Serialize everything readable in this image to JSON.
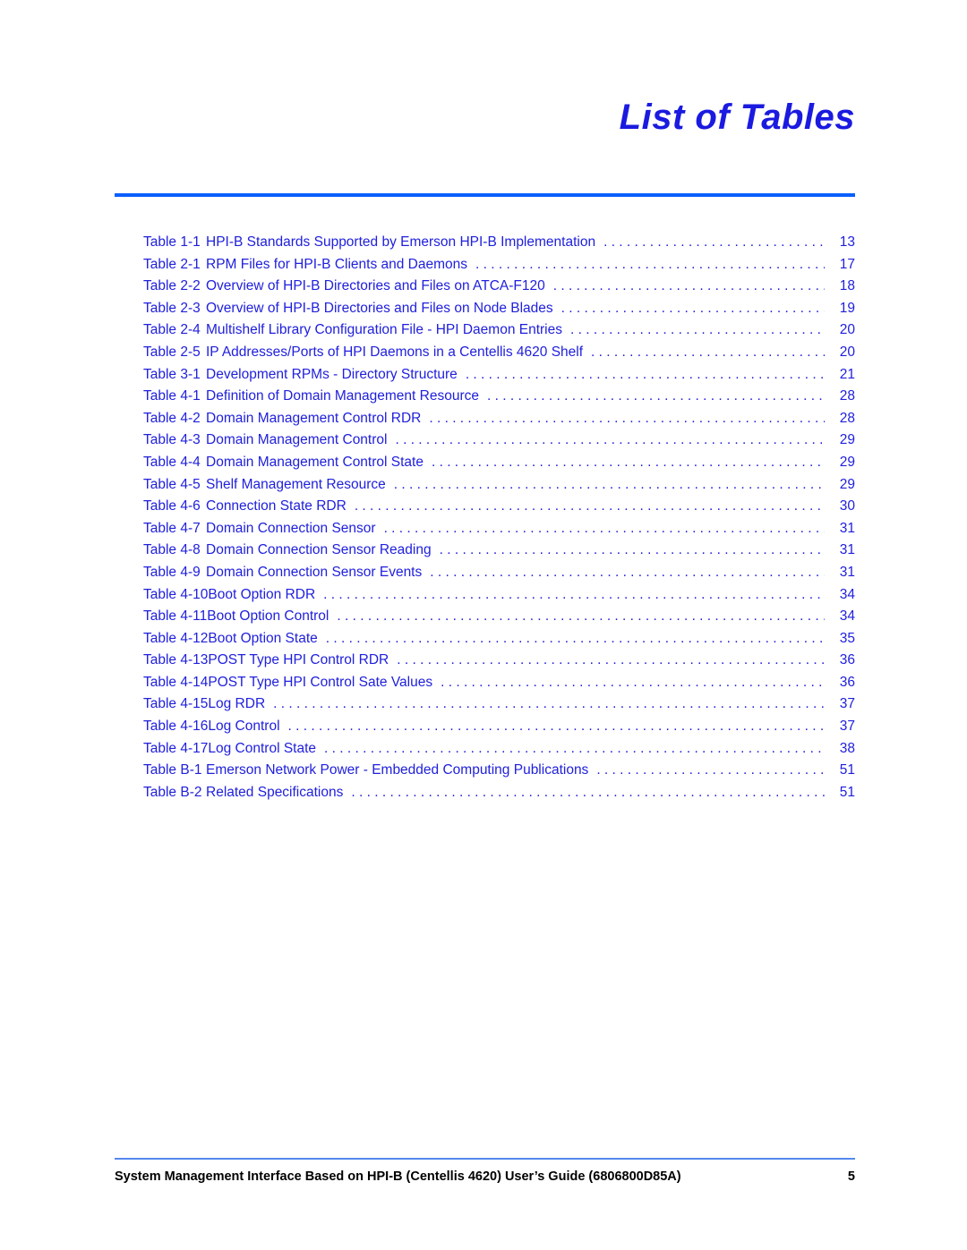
{
  "document": {
    "title": "List of Tables",
    "page_number": "5",
    "footer_text": "System Management Interface Based on HPI-B (Centellis 4620) User’s Guide (6806800D85A)"
  },
  "colors": {
    "title_blue": "#1a1ae0",
    "entry_blue": "#2020dd",
    "header_rule_blue": "#0a5fff",
    "footer_rule_blue": "#5588ee",
    "footer_text_black": "#000000"
  },
  "toc": {
    "entries": [
      {
        "label": "Table 1-1",
        "title": "HPI-B Standards Supported by Emerson HPI-B Implementation",
        "page": "13"
      },
      {
        "label": "Table 2-1",
        "title": "RPM Files for HPI-B Clients and Daemons",
        "page": "17"
      },
      {
        "label": "Table 2-2",
        "title": "Overview of HPI-B Directories and Files on ATCA-F120",
        "page": "18"
      },
      {
        "label": "Table 2-3",
        "title": "Overview of HPI-B Directories and Files on Node Blades",
        "page": "19"
      },
      {
        "label": "Table 2-4",
        "title": "Multishelf Library Configuration File - HPI Daemon Entries",
        "page": "20"
      },
      {
        "label": "Table 2-5",
        "title": "IP Addresses/Ports of HPI Daemons in a Centellis 4620 Shelf",
        "page": "20"
      },
      {
        "label": "Table 3-1",
        "title": "Development RPMs - Directory Structure",
        "page": "21"
      },
      {
        "label": "Table 4-1",
        "title": "Definition of Domain Management Resource",
        "page": "28"
      },
      {
        "label": "Table 4-2",
        "title": "Domain Management Control RDR",
        "page": "28"
      },
      {
        "label": "Table 4-3",
        "title": "Domain Management Control",
        "page": "29"
      },
      {
        "label": "Table 4-4",
        "title": "Domain Management Control State",
        "page": "29"
      },
      {
        "label": "Table 4-5",
        "title": "Shelf Management Resource",
        "page": "29"
      },
      {
        "label": "Table 4-6",
        "title": "Connection State RDR",
        "page": "30"
      },
      {
        "label": "Table 4-7",
        "title": "Domain Connection Sensor",
        "page": "31"
      },
      {
        "label": "Table 4-8",
        "title": "Domain Connection Sensor Reading",
        "page": "31"
      },
      {
        "label": "Table 4-9",
        "title": "Domain Connection Sensor Events",
        "page": "31"
      },
      {
        "label": "Table 4-10",
        "title": "Boot Option RDR",
        "page": "34"
      },
      {
        "label": "Table 4-11",
        "title": "Boot Option Control",
        "page": "34"
      },
      {
        "label": "Table 4-12",
        "title": "Boot Option State",
        "page": "35"
      },
      {
        "label": "Table 4-13",
        "title": "POST Type HPI Control RDR",
        "page": "36"
      },
      {
        "label": "Table 4-14",
        "title": "POST Type HPI Control Sate Values",
        "page": "36"
      },
      {
        "label": "Table 4-15",
        "title": "Log RDR",
        "page": "37"
      },
      {
        "label": "Table 4-16",
        "title": "Log Control",
        "page": "37"
      },
      {
        "label": "Table 4-17",
        "title": "Log Control State",
        "page": "38"
      },
      {
        "label": "Table B-1",
        "title": "Emerson Network Power - Embedded Computing Publications",
        "page": "51"
      },
      {
        "label": "Table B-2",
        "title": "Related Specifications",
        "page": "51"
      }
    ]
  }
}
